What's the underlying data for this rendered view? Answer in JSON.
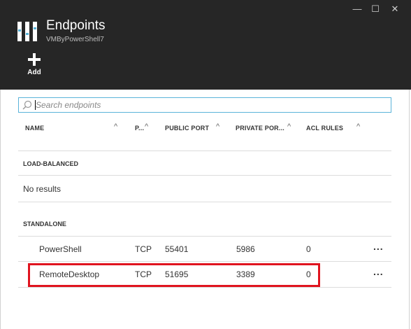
{
  "header": {
    "title": "Endpoints",
    "subtitle": "VMByPowerShell7",
    "add_label": "Add",
    "minimize_icon": "—",
    "maximize_icon": "☐",
    "close_icon": "✕"
  },
  "search": {
    "placeholder": "Search endpoints"
  },
  "columns": [
    {
      "label": "NAME"
    },
    {
      "label": "P..."
    },
    {
      "label": "PUBLIC PORT"
    },
    {
      "label": "PRIVATE POR..."
    },
    {
      "label": "ACL RULES"
    }
  ],
  "sections": {
    "load_balanced": {
      "label": "LOAD-BALANCED",
      "empty_text": "No results"
    },
    "standalone": {
      "label": "STANDALONE"
    }
  },
  "rows": [
    {
      "name": "PowerShell",
      "protocol": "TCP",
      "public_port": "55401",
      "private_port": "5986",
      "acl_rules": "0",
      "more": "..."
    },
    {
      "name": "RemoteDesktop",
      "protocol": "TCP",
      "public_port": "51695",
      "private_port": "3389",
      "acl_rules": "0",
      "more": "..."
    }
  ],
  "colors": {
    "header_bg": "#262626",
    "accent": "#5ab3d9",
    "highlight": "#e0141f"
  }
}
